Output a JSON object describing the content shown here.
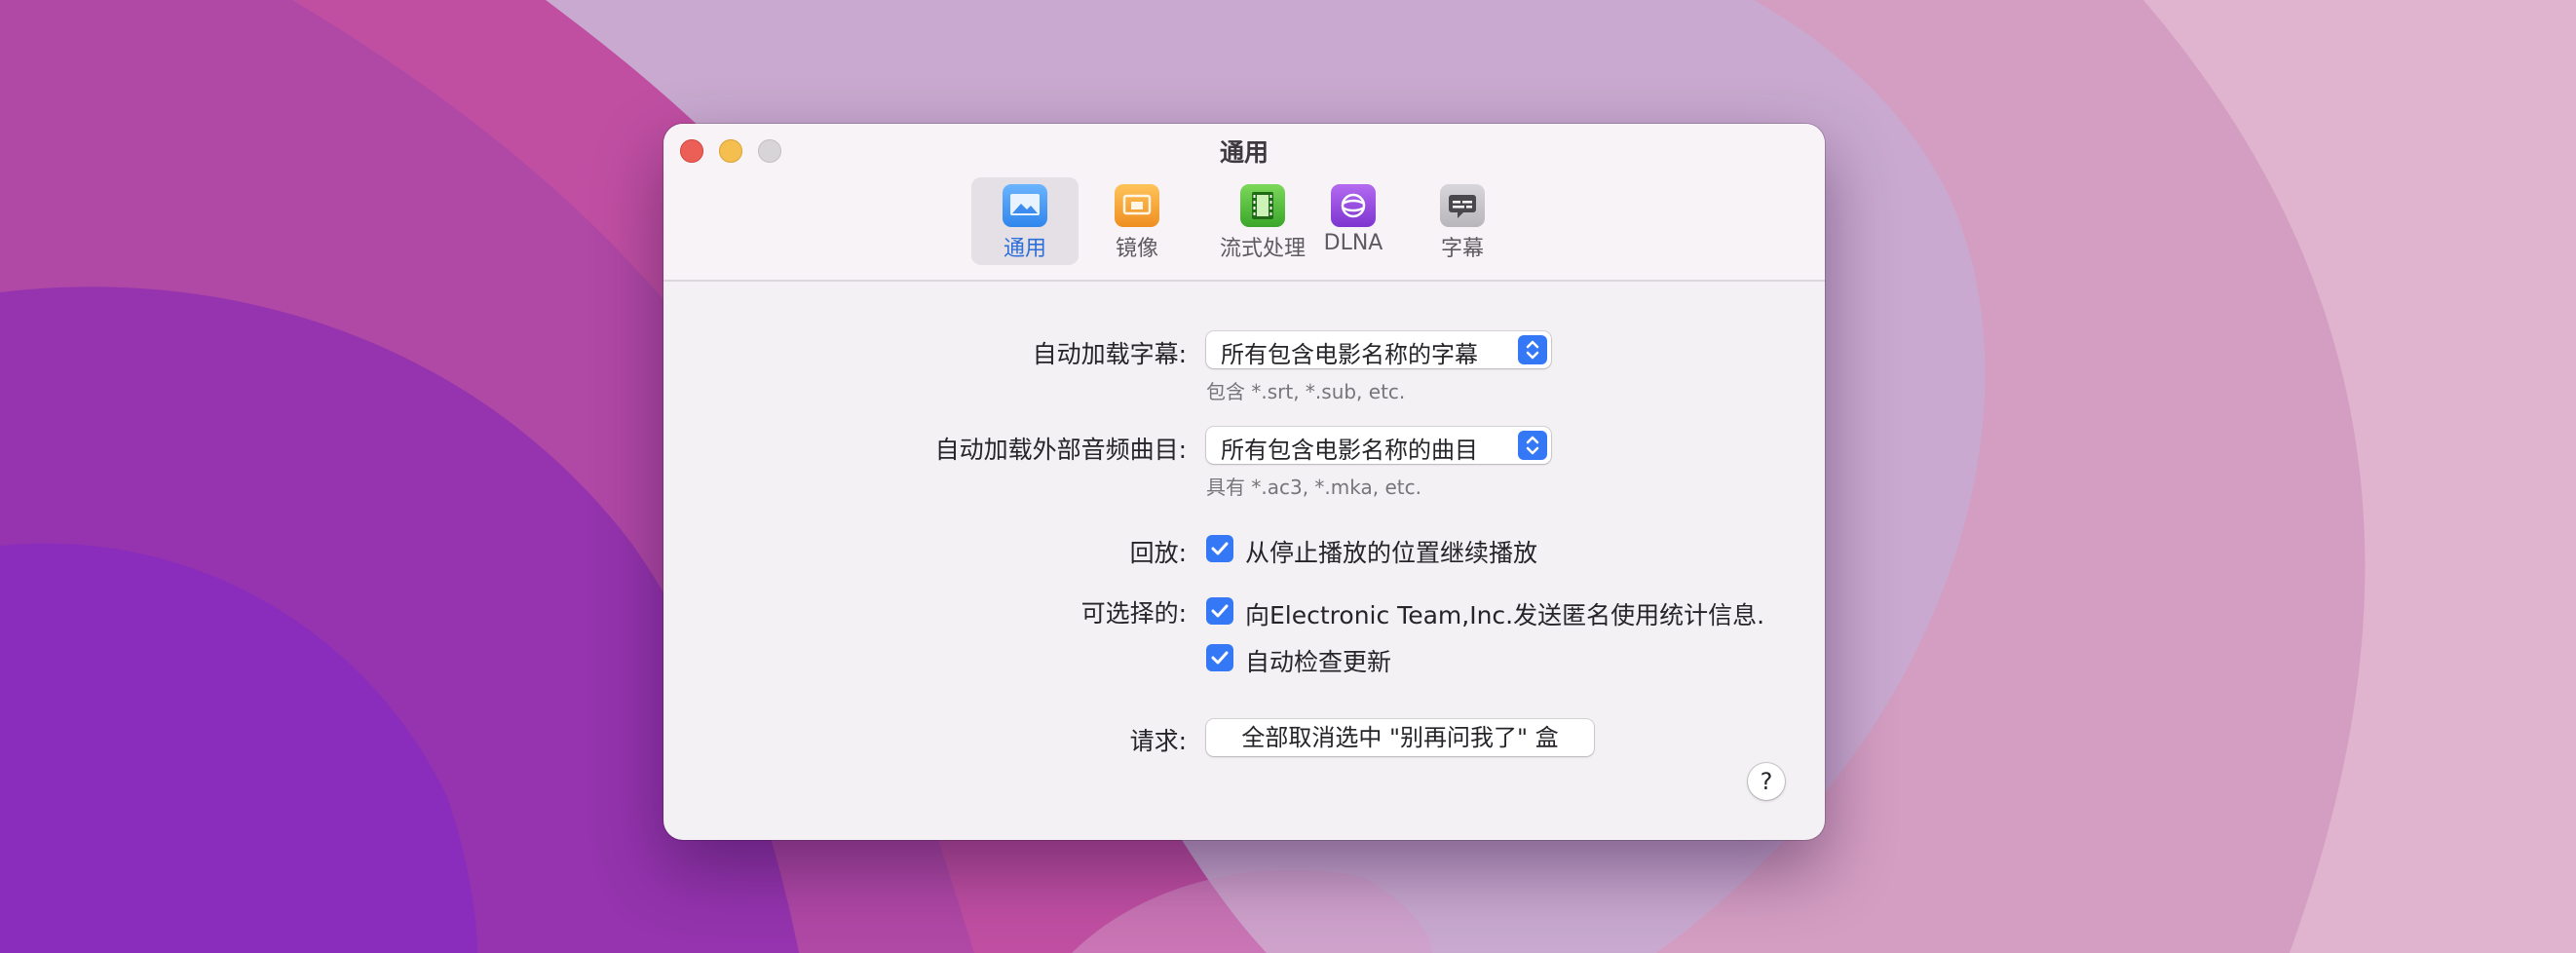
{
  "window": {
    "title": "通用"
  },
  "toolbar": {
    "tabs": [
      {
        "label": "通用",
        "icon": "picture-icon",
        "selected": true
      },
      {
        "label": "镜像",
        "icon": "mirror-icon",
        "selected": false
      },
      {
        "label": "流式处理",
        "icon": "film-icon",
        "selected": false
      },
      {
        "label": "DLNA",
        "icon": "dlna-icon",
        "selected": false
      },
      {
        "label": "字幕",
        "icon": "subtitle-icon",
        "selected": false
      }
    ]
  },
  "settings": {
    "subtitles": {
      "label": "自动加载字幕:",
      "value": "所有包含电影名称的字幕",
      "hint": "包含 *.srt, *.sub, etc."
    },
    "audio": {
      "label": "自动加载外部音频曲目:",
      "value": "所有包含电影名称的曲目",
      "hint": "具有 *.ac3, *.mka, etc."
    },
    "playback": {
      "label": "回放:",
      "checkbox_label": "从停止播放的位置继续播放",
      "checked": true
    },
    "optional": {
      "label": "可选择的:",
      "items": [
        {
          "label": "向Electronic Team,Inc.发送匿名使用统计信息.",
          "checked": true
        },
        {
          "label": "自动检查更新",
          "checked": true
        }
      ]
    },
    "requests": {
      "label": "请求:",
      "button_label": "全部取消选中 \"别再问我了\" 盒"
    }
  },
  "help": {
    "label": "?"
  },
  "colors": {
    "accent": "#3478f6",
    "selected_tab_text": "#2e6ed8",
    "close": "#ec5f57",
    "minimize": "#f4bf4e",
    "zoom_disabled": "#d8d5d8"
  }
}
